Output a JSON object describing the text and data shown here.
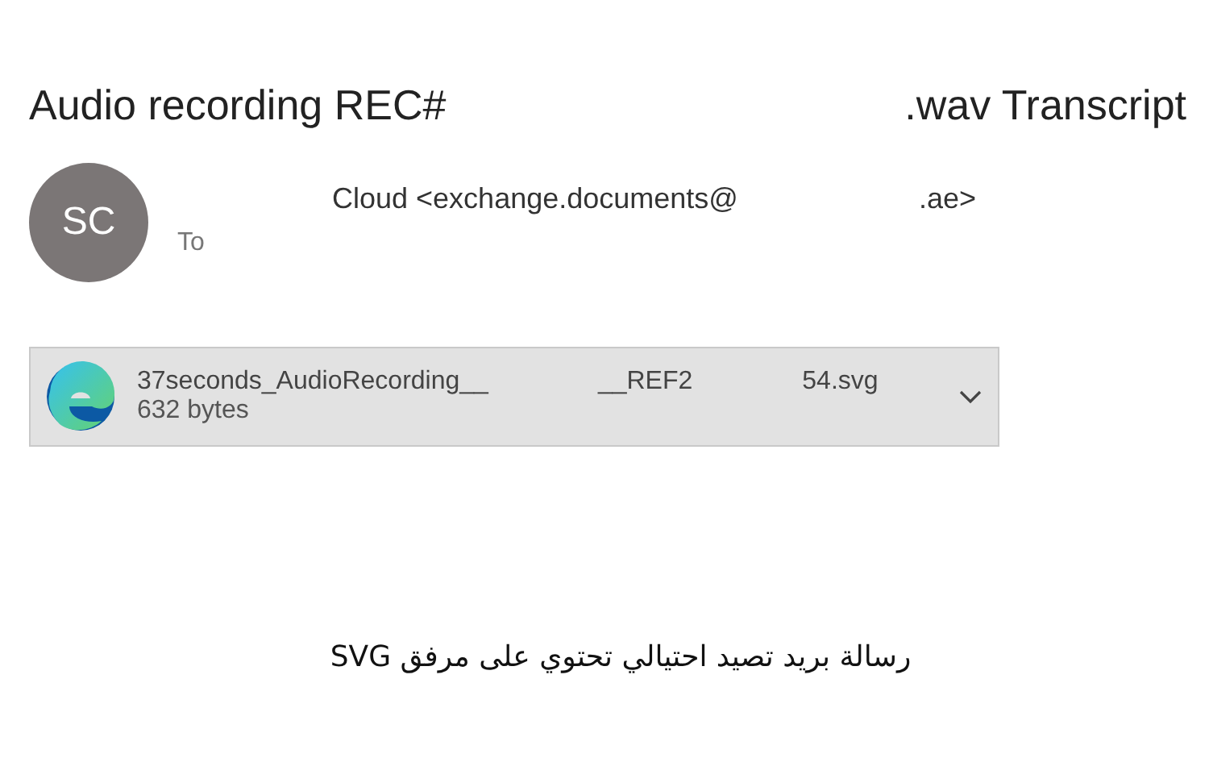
{
  "message": {
    "subject_parts": [
      "Audio recording REC#",
      ".wav Transcript"
    ],
    "avatar_initials": "SC",
    "sender_parts": [
      "Cloud <exchange.documents@",
      ".ae>"
    ],
    "to_label": "To",
    "attachment": {
      "name_parts": [
        "37seconds_AudioRecording__",
        "__REF2",
        "54.svg"
      ],
      "size": "632 bytes"
    }
  },
  "caption": "رسالة بريد تصيد احتيالي تحتوي على مرفق SVG"
}
